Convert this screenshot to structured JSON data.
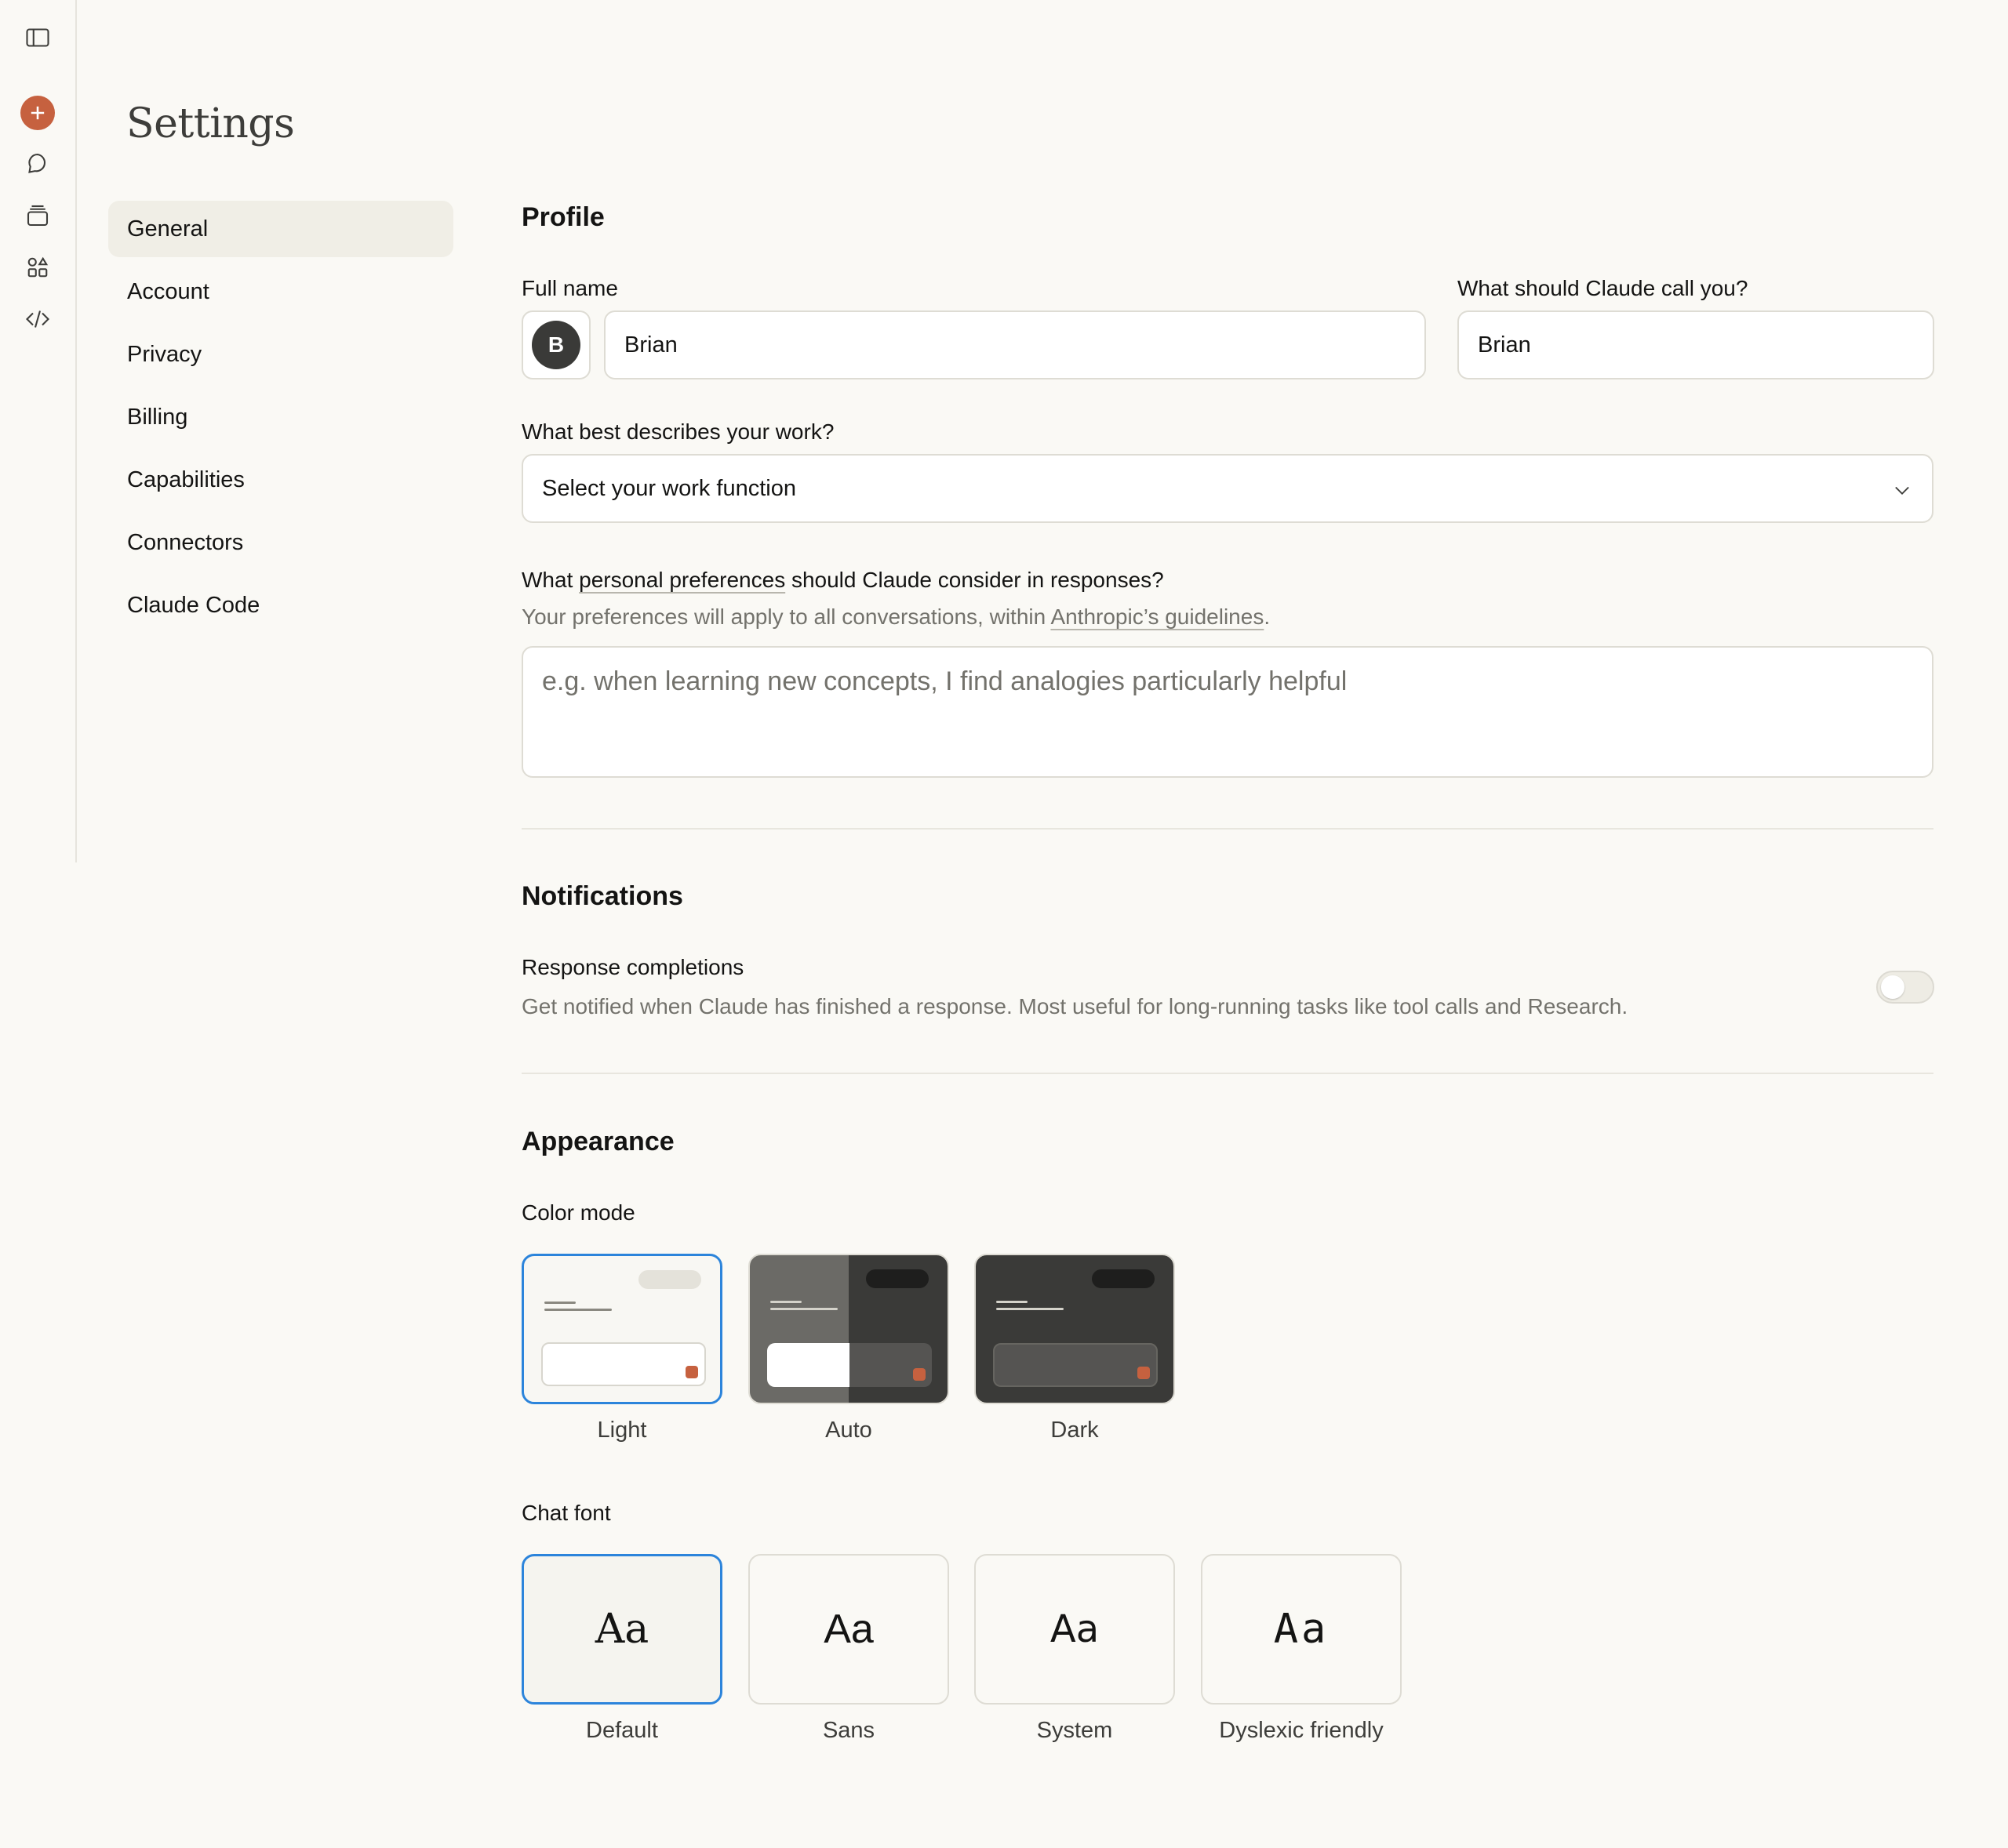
{
  "rail": {
    "icons": [
      "sidebar-toggle-icon",
      "new-chat-icon",
      "chats-icon",
      "projects-icon",
      "artifacts-icon",
      "code-icon"
    ]
  },
  "page_title": "Settings",
  "nav": {
    "items": [
      {
        "label": "General",
        "active": true
      },
      {
        "label": "Account"
      },
      {
        "label": "Privacy"
      },
      {
        "label": "Billing"
      },
      {
        "label": "Capabilities"
      },
      {
        "label": "Connectors"
      },
      {
        "label": "Claude Code"
      }
    ]
  },
  "profile": {
    "title": "Profile",
    "full_name_label": "Full name",
    "avatar_initial": "B",
    "full_name_value": "Brian",
    "call_you_label": "What should Claude call you?",
    "call_you_value": "Brian",
    "work_label": "What best describes your work?",
    "work_select_value": "Select your work function",
    "prefs_label_pre": "What ",
    "prefs_label_link": "personal preferences",
    "prefs_label_post": " should Claude consider in responses?",
    "prefs_help_pre": "Your preferences will apply to all conversations, within ",
    "prefs_help_link": "Anthropic’s guidelines",
    "prefs_help_post": ".",
    "prefs_placeholder": "e.g. when learning new concepts, I find analogies particularly helpful"
  },
  "notifications": {
    "title": "Notifications",
    "response_label": "Response completions",
    "response_desc": "Get notified when Claude has finished a response. Most useful for long-running tasks like tool calls and Research.",
    "response_enabled": false
  },
  "appearance": {
    "title": "Appearance",
    "color_mode_label": "Color mode",
    "color_modes": [
      {
        "label": "Light",
        "selected": true
      },
      {
        "label": "Auto",
        "selected": false
      },
      {
        "label": "Dark",
        "selected": false
      }
    ],
    "chat_font_label": "Chat font",
    "fonts": [
      {
        "label": "Default",
        "sample": "Aa",
        "selected": true
      },
      {
        "label": "Sans",
        "sample": "Aa",
        "selected": false
      },
      {
        "label": "System",
        "sample": "Aa",
        "selected": false
      },
      {
        "label": "Dyslexic friendly",
        "sample": "Aa",
        "selected": false
      }
    ]
  },
  "colors": {
    "accent": "#c6613f",
    "selected_border": "#2c84db",
    "background": "#faf9f5",
    "nav_active": "#f0eee6"
  }
}
